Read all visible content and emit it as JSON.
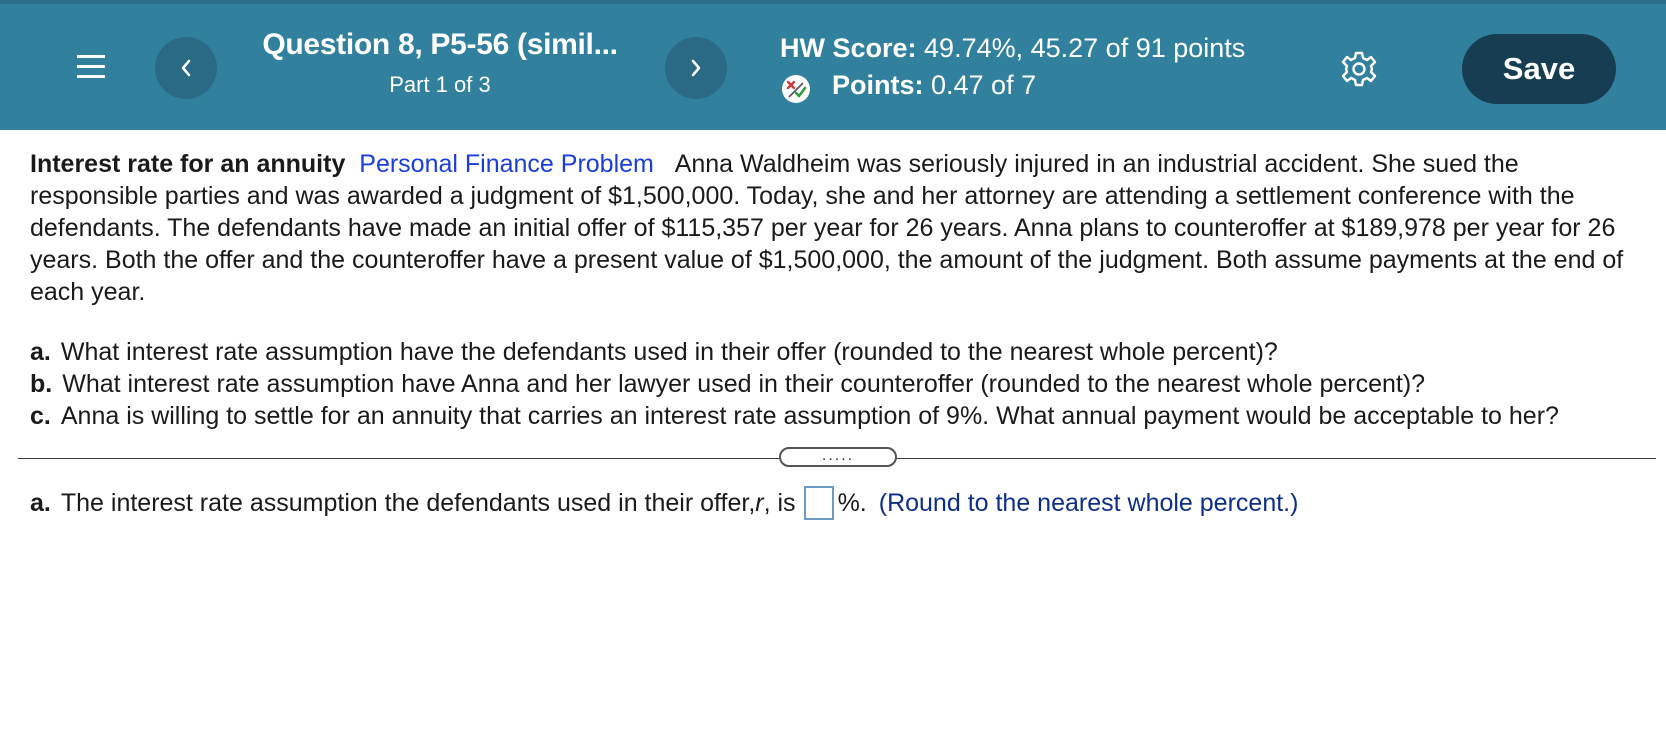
{
  "header": {
    "question_title": "Question 8, P5-56 (simil...",
    "part": "Part 1 of 3",
    "hw_score_label": "HW Score:",
    "hw_score_value": " 49.74%, 45.27 of 91 points",
    "points_label": "Points:",
    "points_value": " 0.47 of 7",
    "save_label": "Save",
    "prev_glyph": "‹",
    "next_glyph": "›"
  },
  "icons": {
    "menu": "menu-icon",
    "previous": "chevron-left-icon",
    "next": "chevron-right-icon",
    "points_status": "partial-credit-icon",
    "settings": "gear-icon"
  },
  "problem": {
    "topic": "Interest rate for an annuity",
    "category": "Personal Finance Problem",
    "text": "Anna Waldheim was seriously injured in an industrial accident.   She sued the responsible parties and was awarded a judgment of $1,500,000.  Today, she and her attorney are attending a settlement conference with the defendants.  The defendants have made an initial offer of $115,357 per year for 26 years.   Anna plans to counteroffer at $189,978 per year for 26 years.  Both the offer and the counteroffer have a present value of $1,500,000, the amount of the judgment.  Both assume payments at the end of each year."
  },
  "questions": [
    {
      "letter": "a.",
      "text": "What interest rate assumption have the defendants used in their offer (rounded to the nearest whole percent)?"
    },
    {
      "letter": "b.",
      "text": "What interest rate assumption have Anna and her lawyer used in their counteroffer (rounded to the nearest whole percent)?"
    },
    {
      "letter": "c.",
      "text": "Anna is willing to settle for an annuity that carries an interest rate assumption of 9%.  What annual payment would be acceptable to her?"
    }
  ],
  "expand_label": ".....",
  "answer": {
    "letter": "a.",
    "prefix": "The interest rate assumption the defendants used in their offer, ",
    "variable": "r",
    "middle": ", is",
    "input_value": "",
    "suffix": "%.",
    "hint": "(Round to the nearest whole percent.)"
  },
  "colors": {
    "header_bg": "#31809e",
    "save_bg": "#173d52",
    "link_blue": "#1a3dde",
    "hint_blue": "#0d2e8a"
  }
}
